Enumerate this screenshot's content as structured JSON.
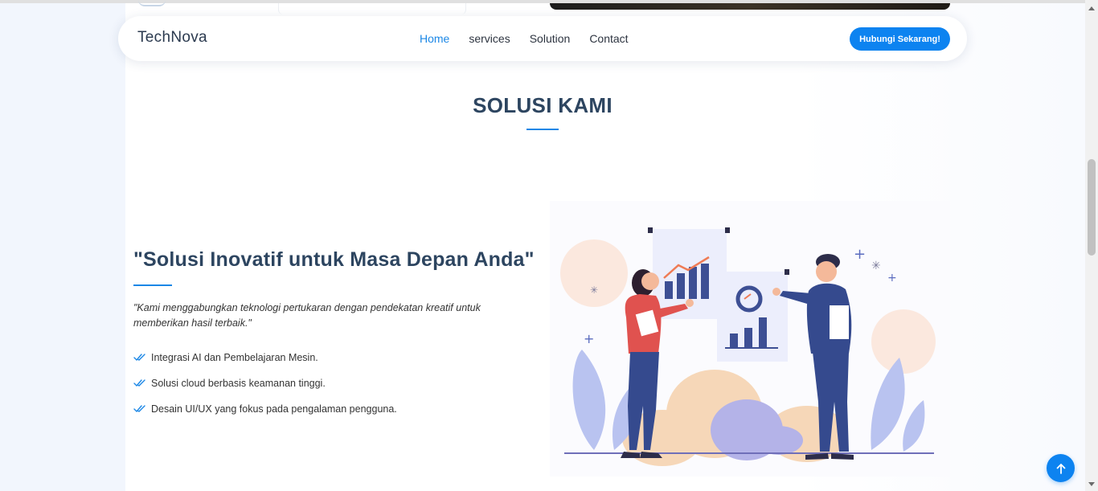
{
  "navbar": {
    "brand": "TechNova",
    "links": [
      {
        "label": "Home",
        "active": true
      },
      {
        "label": "services",
        "active": false
      },
      {
        "label": "Solution",
        "active": false
      },
      {
        "label": "Contact",
        "active": false
      }
    ],
    "cta_label": "Hubungi Sekarang!"
  },
  "section": {
    "title": "SOLUSI KAMI"
  },
  "content": {
    "headline": "\"Solusi Inovatif untuk Masa Depan Anda\"",
    "quote": "\"Kami menggabungkan teknologi pertukaran dengan pendekatan kreatif untuk memberikan hasil terbaik.\"",
    "features": [
      "Integrasi AI dan Pembelajaran Mesin.",
      "Solusi cloud berbasis keamanan tinggi.",
      "Desain UI/UX yang fokus pada pengalaman pengguna."
    ]
  },
  "icons": {
    "feature": "double-check-icon",
    "back_to_top": "arrow-up-icon"
  },
  "colors": {
    "accent": "#1b87e6",
    "button": "#0d83f0",
    "heading": "#2d4560"
  }
}
